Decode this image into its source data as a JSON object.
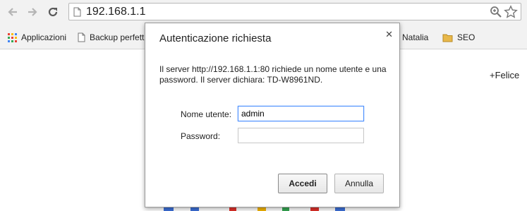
{
  "browser": {
    "url": "192.168.1.1",
    "icons": {
      "back": "back-arrow-icon",
      "forward": "forward-arrow-icon",
      "reload": "reload-icon",
      "page": "page-icon",
      "zoom": "zoom-icon",
      "bookmark_star": "star-icon"
    }
  },
  "bookmarks": {
    "items": [
      {
        "label": "Applicazioni",
        "icon": "apps-grid-icon"
      },
      {
        "label": "Backup perfett",
        "icon": "page-icon"
      },
      {
        "label": "Natalia",
        "icon": "folder-icon"
      },
      {
        "label": "SEO",
        "icon": "folder-icon"
      }
    ]
  },
  "page": {
    "felice_link": "+Felice"
  },
  "dialog": {
    "title": "Autenticazione richiesta",
    "message": "Il server http://192.168.1.1:80 richiede un nome utente e una password. Il server dichiara: TD-W8961ND.",
    "username_label": "Nome utente:",
    "username_value": "admin",
    "password_label": "Password:",
    "password_value": "",
    "login_button": "Accedi",
    "cancel_button": "Annulla"
  },
  "colors": {
    "folder": "#e8b84a",
    "focus_border": "#4d90fe"
  }
}
